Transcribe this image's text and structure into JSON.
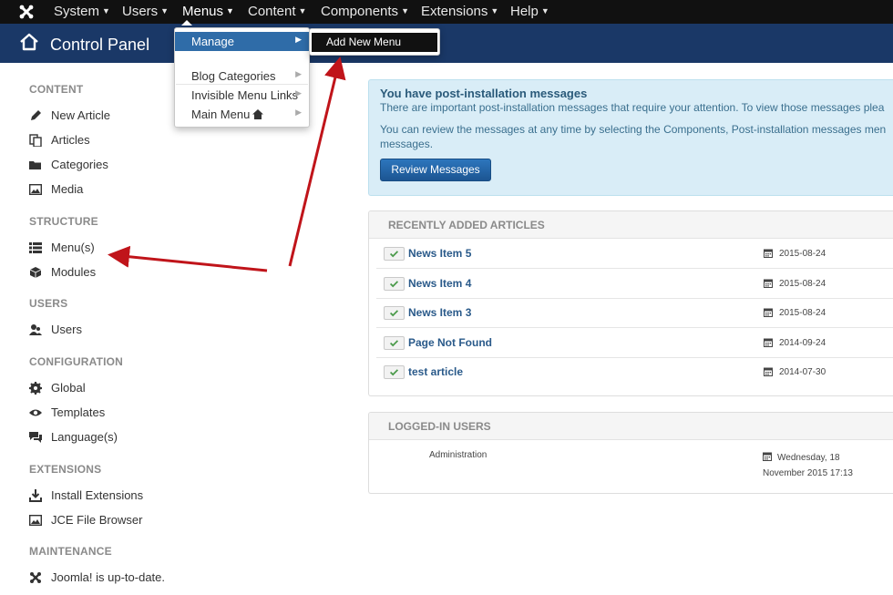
{
  "navbar": {
    "items": [
      {
        "label": "System"
      },
      {
        "label": "Users"
      },
      {
        "label": "Menus"
      },
      {
        "label": "Content"
      },
      {
        "label": "Components"
      },
      {
        "label": "Extensions"
      },
      {
        "label": "Help"
      }
    ]
  },
  "header": {
    "title": "Control Panel"
  },
  "menus_dropdown": {
    "items": [
      {
        "label": "Manage"
      },
      {
        "label": "Blog Categories"
      },
      {
        "label": "Invisible Menu Links"
      },
      {
        "label": "Main Menu"
      }
    ],
    "submenu": {
      "label": "Add New Menu"
    }
  },
  "sidebar": {
    "sections": [
      {
        "title": "CONTENT",
        "links": [
          {
            "label": "New Article",
            "icon": "pencil-icon"
          },
          {
            "label": "Articles",
            "icon": "copy-icon"
          },
          {
            "label": "Categories",
            "icon": "folder-icon"
          },
          {
            "label": "Media",
            "icon": "image-icon"
          }
        ]
      },
      {
        "title": "STRUCTURE",
        "links": [
          {
            "label": "Menu(s)",
            "icon": "list-icon"
          },
          {
            "label": "Modules",
            "icon": "cube-icon"
          }
        ]
      },
      {
        "title": "USERS",
        "links": [
          {
            "label": "Users",
            "icon": "users-icon"
          }
        ]
      },
      {
        "title": "CONFIGURATION",
        "links": [
          {
            "label": "Global",
            "icon": "gear-icon"
          },
          {
            "label": "Templates",
            "icon": "eye-icon"
          },
          {
            "label": "Language(s)",
            "icon": "comments-icon"
          }
        ]
      },
      {
        "title": "EXTENSIONS",
        "links": [
          {
            "label": "Install Extensions",
            "icon": "download-icon"
          },
          {
            "label": "JCE File Browser",
            "icon": "image-icon"
          }
        ]
      },
      {
        "title": "MAINTENANCE",
        "links": [
          {
            "label": "Joomla! is up-to-date.",
            "icon": "joomla-icon"
          }
        ]
      }
    ]
  },
  "messages": {
    "title": "You have post-installation messages",
    "line1": "There are important post-installation messages that require your attention. To view those messages plea",
    "line2": "You can review the messages at any time by selecting the Components, Post-installation messages men",
    "line3": "messages.",
    "button": "Review Messages"
  },
  "recent_articles": {
    "heading": "RECENTLY ADDED ARTICLES",
    "rows": [
      {
        "title": "News Item 5",
        "date": "2015-08-24"
      },
      {
        "title": "News Item 4",
        "date": "2015-08-24"
      },
      {
        "title": "News Item 3",
        "date": "2015-08-24"
      },
      {
        "title": "Page Not Found",
        "date": "2014-09-24"
      },
      {
        "title": "test article",
        "date": "2014-07-30"
      }
    ]
  },
  "logged_in_users": {
    "heading": "LOGGED-IN USERS",
    "rows": [
      {
        "name": "Administration",
        "time_line1": "Wednesday, 18",
        "time_line2": "November 2015 17:13"
      }
    ]
  },
  "colors": {
    "navbar_bg": "#111111",
    "header_bg": "#1a3867",
    "accent_blue": "#2f6ca8",
    "link_blue": "#2a5a8a",
    "alert_bg": "#d9edf7",
    "annotation_red": "#c0141a"
  }
}
